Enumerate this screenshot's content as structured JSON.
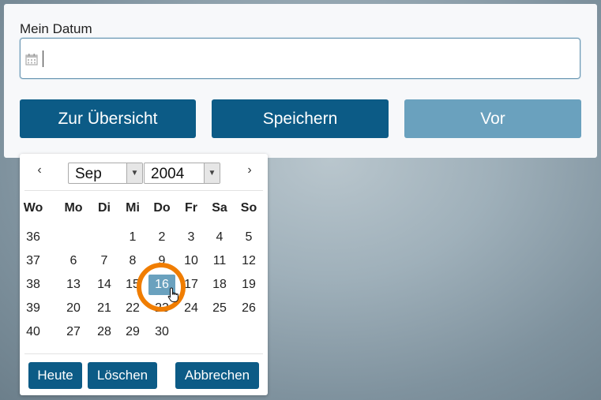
{
  "form": {
    "label": "Mein Datum",
    "input_value": "",
    "buttons": {
      "overview": "Zur Übersicht",
      "save": "Speichern",
      "next": "Vor"
    }
  },
  "datepicker": {
    "prev": "‹",
    "next": "›",
    "month": "Sep",
    "year": "2004",
    "weekdays": [
      "Wo",
      "Mo",
      "Di",
      "Mi",
      "Do",
      "Fr",
      "Sa",
      "So"
    ],
    "weeks": [
      [
        "36",
        "",
        "",
        "1",
        "2",
        "3",
        "4",
        "5"
      ],
      [
        "37",
        "6",
        "7",
        "8",
        "9",
        "10",
        "11",
        "12"
      ],
      [
        "38",
        "13",
        "14",
        "15",
        "16",
        "17",
        "18",
        "19"
      ],
      [
        "39",
        "20",
        "21",
        "22",
        "23",
        "24",
        "25",
        "26"
      ],
      [
        "40",
        "27",
        "28",
        "29",
        "30",
        "",
        "",
        ""
      ]
    ],
    "selected": "16",
    "footer": {
      "today": "Heute",
      "clear": "Löschen",
      "cancel": "Abbrechen"
    }
  },
  "colors": {
    "primary": "#0c5b86",
    "disabled": "#6aa1be",
    "highlight_ring": "#f07d00"
  }
}
